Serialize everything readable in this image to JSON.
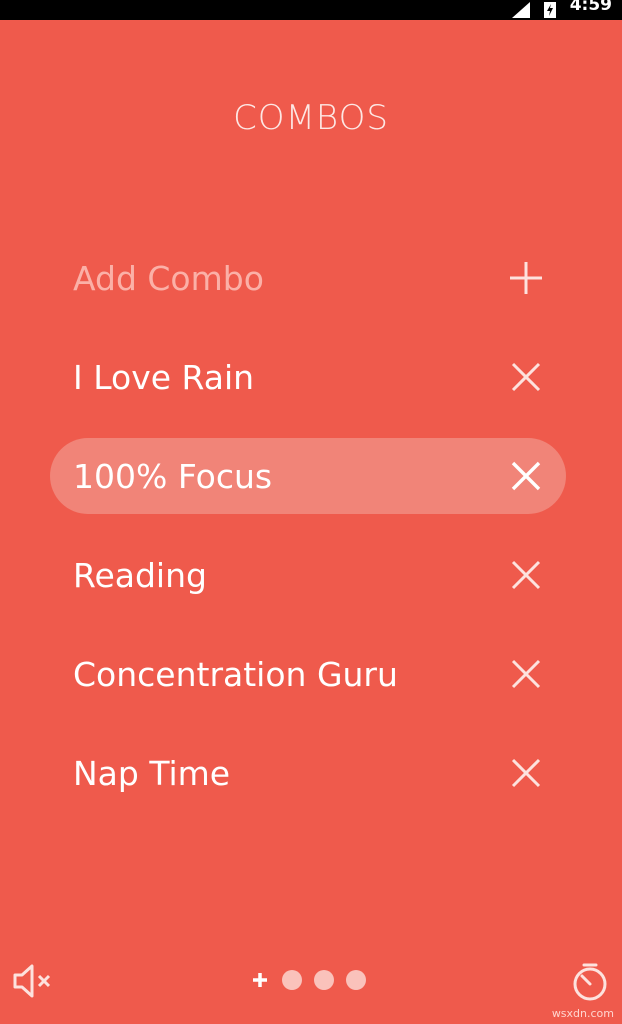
{
  "status_bar": {
    "time": "4:59"
  },
  "screen": {
    "title": "COMBOS"
  },
  "combos": {
    "add_label": "Add Combo",
    "items": [
      {
        "label": "I Love Rain"
      },
      {
        "label": "100% Focus"
      },
      {
        "label": "Reading"
      },
      {
        "label": "Concentration Guru"
      },
      {
        "label": "Nap Time"
      }
    ],
    "active_index": 1
  },
  "pager": {
    "page_count": 3,
    "current": "add"
  },
  "watermark": "wsxdn.com",
  "colors": {
    "background": "#EF5A4C",
    "active_row": "#F18478",
    "add_text": "#fbb0a7",
    "text": "#ffffff"
  },
  "icons": {
    "mute": "speaker-muted-icon",
    "timer": "timer-icon",
    "add": "plus-icon",
    "remove": "close-icon"
  }
}
